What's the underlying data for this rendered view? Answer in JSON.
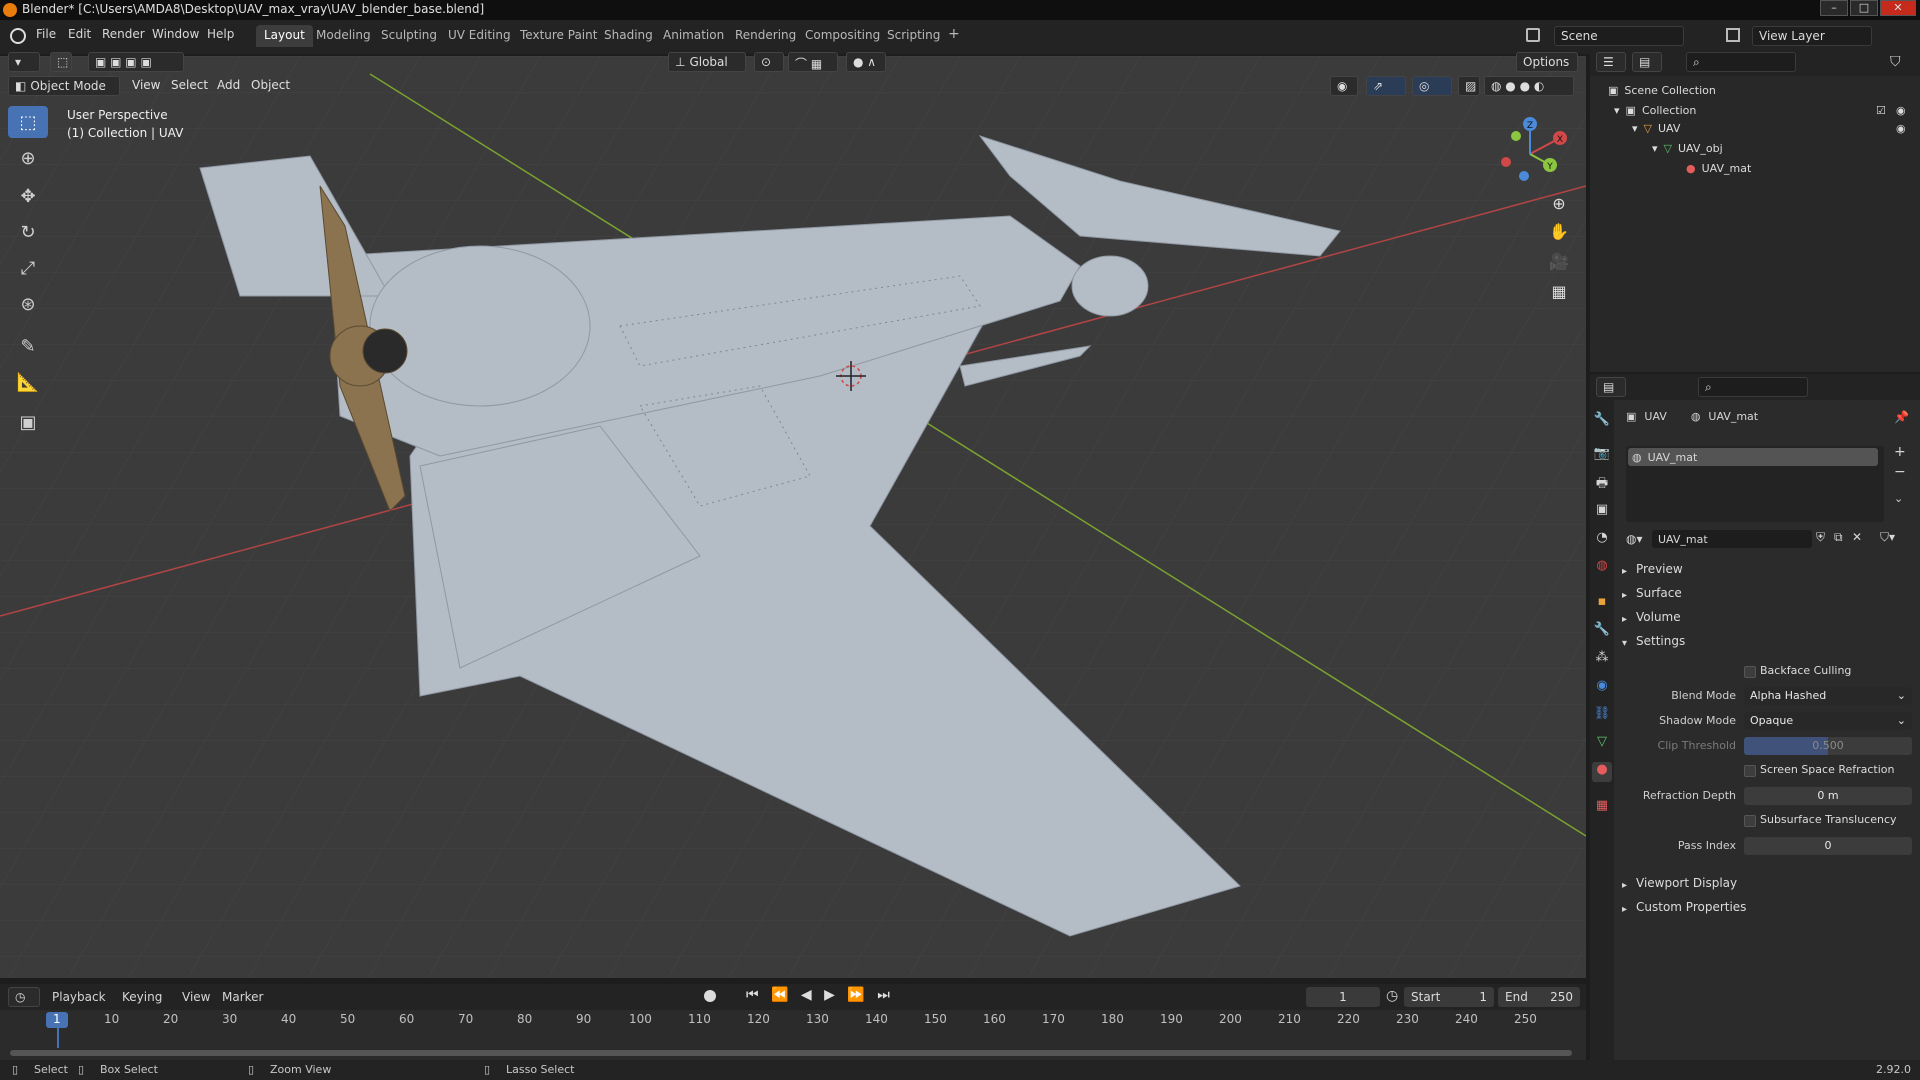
{
  "window": {
    "title": "Blender* [C:\\Users\\AMDA8\\Desktop\\UAV_max_vray\\UAV_blender_base.blend]",
    "minimize": "–",
    "maximize": "□",
    "close": "✕"
  },
  "menu": [
    "File",
    "Edit",
    "Render",
    "Window",
    "Help"
  ],
  "workspaces": [
    "Layout",
    "Modeling",
    "Sculpting",
    "UV Editing",
    "Texture Paint",
    "Shading",
    "Animation",
    "Rendering",
    "Compositing",
    "Scripting"
  ],
  "workspace_add": "+",
  "scene": {
    "name": "Scene",
    "view_layer": "View Layer"
  },
  "viewport": {
    "transform_orientation": "Global",
    "options_label": "Options",
    "mode": "Object Mode",
    "menus": [
      "View",
      "Select",
      "Add",
      "Object"
    ],
    "perspective": "User Perspective",
    "collection_info": "(1) Collection | UAV",
    "gizmo_axes": {
      "x": "X",
      "y": "Y",
      "z": "Z"
    },
    "tools": [
      "select-box-tool",
      "cursor-tool",
      "move-tool",
      "rotate-tool",
      "scale-tool",
      "transform-tool",
      "annotate-tool",
      "measure-tool",
      "add-cube-tool"
    ]
  },
  "timeline": {
    "menus": [
      "Playback",
      "Keying",
      "View",
      "Marker"
    ],
    "current_frame": "1",
    "start_label": "Start",
    "start": "1",
    "end_label": "End",
    "end": "250",
    "ticks": [
      "1",
      "10",
      "20",
      "30",
      "40",
      "50",
      "60",
      "70",
      "80",
      "90",
      "100",
      "110",
      "120",
      "130",
      "140",
      "150",
      "160",
      "170",
      "180",
      "190",
      "200",
      "210",
      "220",
      "230",
      "240",
      "250"
    ]
  },
  "statusbar": {
    "select": "Select",
    "box_select": "Box Select",
    "zoom_view": "Zoom View",
    "lasso_select": "Lasso Select",
    "version": "2.92.0"
  },
  "outliner": {
    "rows": [
      "Scene Collection",
      "Collection",
      "UAV",
      "UAV_obj",
      "UAV_mat"
    ]
  },
  "properties": {
    "breadcrumb_object": "UAV",
    "breadcrumb_material": "UAV_mat",
    "slot_name": "UAV_mat",
    "material_name": "UAV_mat",
    "panels": {
      "preview": "Preview",
      "surface": "Surface",
      "volume": "Volume",
      "settings": "Settings",
      "viewport_display": "Viewport Display",
      "custom_properties": "Custom Properties"
    },
    "settings": {
      "backface_culling": "Backface Culling",
      "blend_mode_label": "Blend Mode",
      "blend_mode": "Alpha Hashed",
      "shadow_mode_label": "Shadow Mode",
      "shadow_mode": "Opaque",
      "clip_threshold_label": "Clip Threshold",
      "clip_threshold": "0.500",
      "screen_space_refraction": "Screen Space Refraction",
      "refraction_depth_label": "Refraction Depth",
      "refraction_depth": "0 m",
      "subsurface_translucency": "Subsurface Translucency",
      "pass_index_label": "Pass Index",
      "pass_index": "0"
    }
  },
  "colors": {
    "accent": "#4772b3",
    "viewport_bg": "#3b3b3b",
    "model": "#b4bcc6",
    "x_axis": "#d04848",
    "y_axis": "#8cc63e",
    "z_axis": "#4a8ad8"
  }
}
